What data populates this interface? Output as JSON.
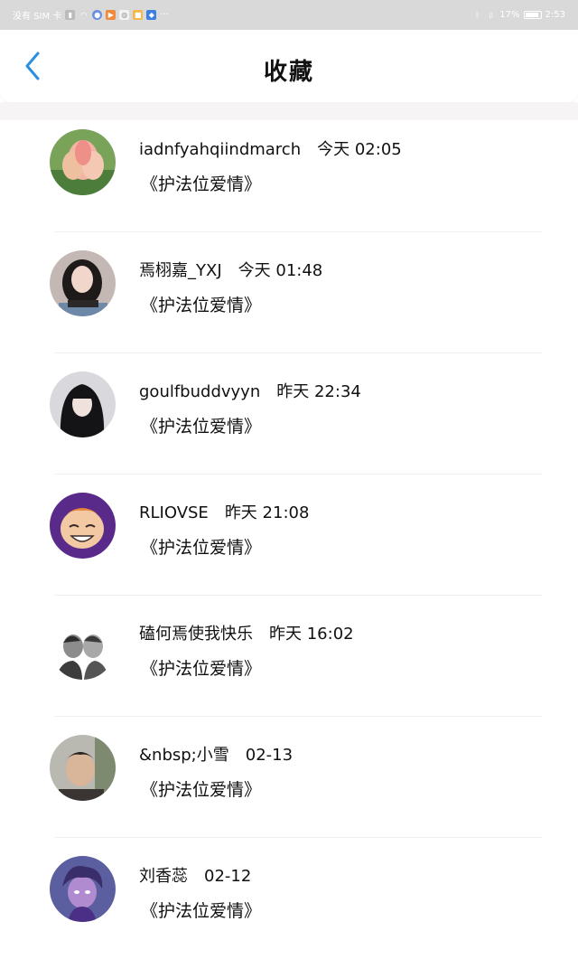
{
  "status_bar": {
    "carrier": "没有 SIM 卡",
    "battery": "17%",
    "time": "2:53"
  },
  "header": {
    "title": "收藏",
    "back_icon": "chevron-left-icon"
  },
  "items": [
    {
      "user": "iadnfyahqiindmarch",
      "time": "今天 02:05",
      "title": "《护法位爱情》",
      "avatar": "lotus-flower"
    },
    {
      "user": "焉栩嘉_YXJ",
      "time": "今天 01:48",
      "title": "《护法位爱情》",
      "avatar": "girl-dark-hair"
    },
    {
      "user": "goulfbuddvyyn",
      "time": "昨天 22:34",
      "title": "《护法位爱情》",
      "avatar": "anime-girl-black-hair"
    },
    {
      "user": "RLIOVSE",
      "time": "昨天 21:08",
      "title": "《护法位爱情》",
      "avatar": "cartoon-laughing"
    },
    {
      "user": "磕何焉使我快乐",
      "time": "昨天 16:02",
      "title": "《护法位爱情》",
      "avatar": "two-people-bw"
    },
    {
      "user": "&nbsp;小雪",
      "time": "02-13",
      "title": "《护法位爱情》",
      "avatar": "selfie-boy"
    },
    {
      "user": "刘香蕊",
      "time": "02-12",
      "title": "《护法位爱情》",
      "avatar": "cartoon-purple"
    }
  ]
}
